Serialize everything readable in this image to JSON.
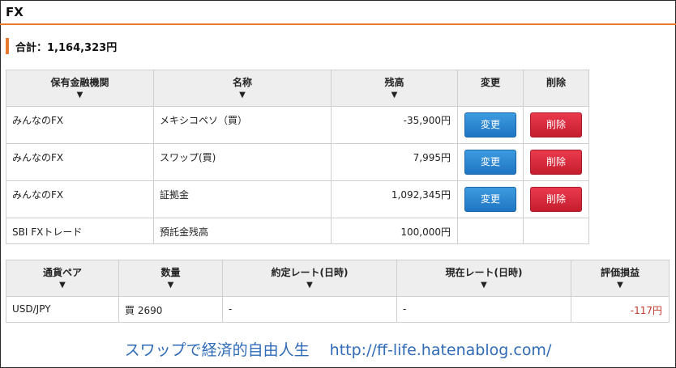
{
  "section_title": "FX",
  "total_label": "合計：1,164,323円",
  "accounts_table": {
    "headers": [
      "保有金融機関",
      "名称",
      "残高",
      "変更",
      "削除"
    ],
    "sort_arrow": "▼",
    "rows": [
      {
        "institution": "みんなのFX",
        "name": "メキシコペソ（買）",
        "balance": "-35,900円",
        "edit_label": "変更",
        "delete_label": "削除"
      },
      {
        "institution": "みんなのFX",
        "name": "スワップ(買)",
        "balance": "7,995円",
        "edit_label": "変更",
        "delete_label": "削除"
      },
      {
        "institution": "みんなのFX",
        "name": "証拠金",
        "balance": "1,092,345円",
        "edit_label": "変更",
        "delete_label": "削除"
      },
      {
        "institution": "SBI FXトレード",
        "name": "預託金残高",
        "balance": "100,000円"
      }
    ]
  },
  "positions_table": {
    "headers": [
      "通貨ペア",
      "数量",
      "約定レート(日時)",
      "現在レート(日時)",
      "評価損益"
    ],
    "rows": [
      {
        "pair": "USD/JPY",
        "quantity": "買 2690",
        "entry_rate": "-",
        "current_rate": "-",
        "pnl": "-117円"
      }
    ]
  },
  "footer_text": "スワップで経済的自由人生　 http://ff-life.hatenablog.com/",
  "colors": {
    "accent": "#e9792b",
    "edit_button": "#1f75c2",
    "delete_button": "#c51d2e",
    "negative": "#c0392b",
    "footer": "#2f6bb8"
  }
}
